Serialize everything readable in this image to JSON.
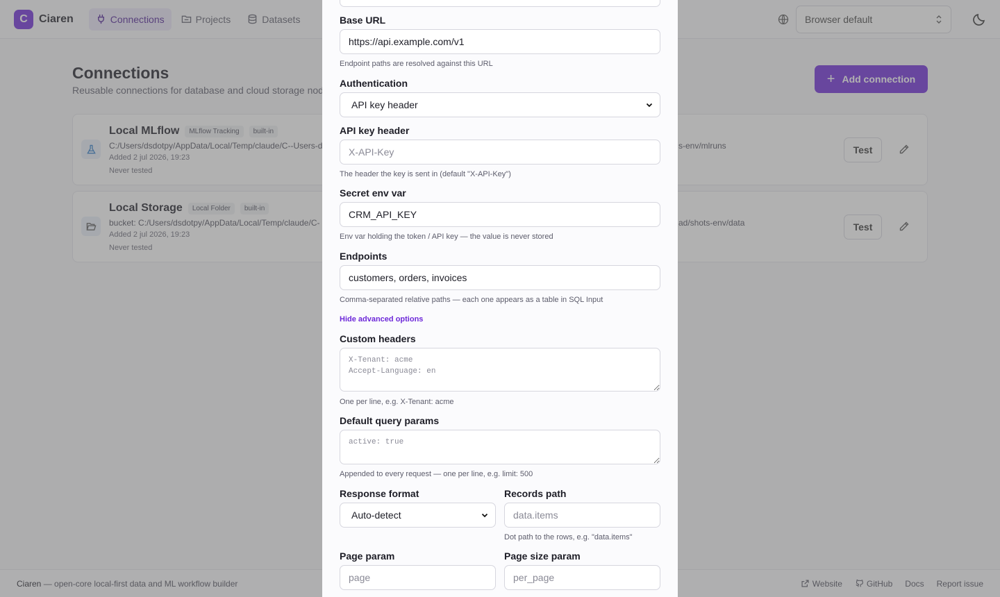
{
  "app": {
    "logo_letter": "C",
    "name": "Ciaren",
    "accent": "#6d28d9"
  },
  "nav": {
    "items": [
      {
        "label": "Connections",
        "icon": "plug-icon"
      },
      {
        "label": "Projects",
        "icon": "folder-icon"
      },
      {
        "label": "Datasets",
        "icon": "database-icon"
      }
    ]
  },
  "topbar": {
    "language_value": "Browser default"
  },
  "page": {
    "title": "Connections",
    "subtitle": "Reusable connections for database and cloud storage nodes",
    "add_button": "Add connection",
    "connections": [
      {
        "name": "Local MLflow",
        "tags": [
          "MLflow Tracking",
          "built-in"
        ],
        "path_left": "C:/Users/dsdotpy/AppData/Local/Temp/claude/C--Users-d",
        "path_right": "s-env/mlruns",
        "added": "Added 2 jul 2026, 19:23",
        "tested": "Never tested",
        "test_label": "Test",
        "icon": "flask-icon"
      },
      {
        "name": "Local Storage",
        "tags": [
          "Local Folder",
          "built-in"
        ],
        "path_left": "bucket: C:/Users/dsdotpy/AppData/Local/Temp/claude/C-",
        "path_right": "ad/shots-env/data",
        "added": "Added 2 jul 2026, 19:23",
        "tested": "Never tested",
        "test_label": "Test",
        "icon": "folder-open-icon"
      }
    ]
  },
  "form": {
    "base_url": {
      "label": "Base URL",
      "value": "https://api.example.com/v1",
      "hint": "Endpoint paths are resolved against this URL"
    },
    "auth": {
      "label": "Authentication",
      "value": "API key header"
    },
    "api_key_header": {
      "label": "API key header",
      "placeholder": "X-API-Key",
      "hint": "The header the key is sent in (default \"X-API-Key\")"
    },
    "secret_env": {
      "label": "Secret env var",
      "value": "CRM_API_KEY",
      "hint": "Env var holding the token / API key — the value is never stored"
    },
    "endpoints": {
      "label": "Endpoints",
      "value": "customers, orders, invoices",
      "hint": "Comma-separated relative paths — each one appears as a table in SQL Input"
    },
    "advanced_toggle": "Hide advanced options",
    "custom_headers": {
      "label": "Custom headers",
      "placeholder": "X-Tenant: acme\nAccept-Language: en",
      "hint": "One per line, e.g. X-Tenant: acme"
    },
    "query_params": {
      "label": "Default query params",
      "placeholder": "active: true",
      "hint": "Appended to every request — one per line, e.g. limit: 500"
    },
    "response_format": {
      "label": "Response format",
      "value": "Auto-detect"
    },
    "records_path": {
      "label": "Records path",
      "placeholder": "data.items",
      "hint": "Dot path to the rows, e.g. \"data.items\""
    },
    "page_param": {
      "label": "Page param",
      "placeholder": "page"
    },
    "page_size_param": {
      "label": "Page size param",
      "placeholder": "per_page"
    }
  },
  "footer": {
    "brand": "Ciaren",
    "tagline": " — open-core local-first data and ML workflow builder",
    "links": [
      "Website",
      "GitHub",
      "Docs",
      "Report issue"
    ]
  }
}
